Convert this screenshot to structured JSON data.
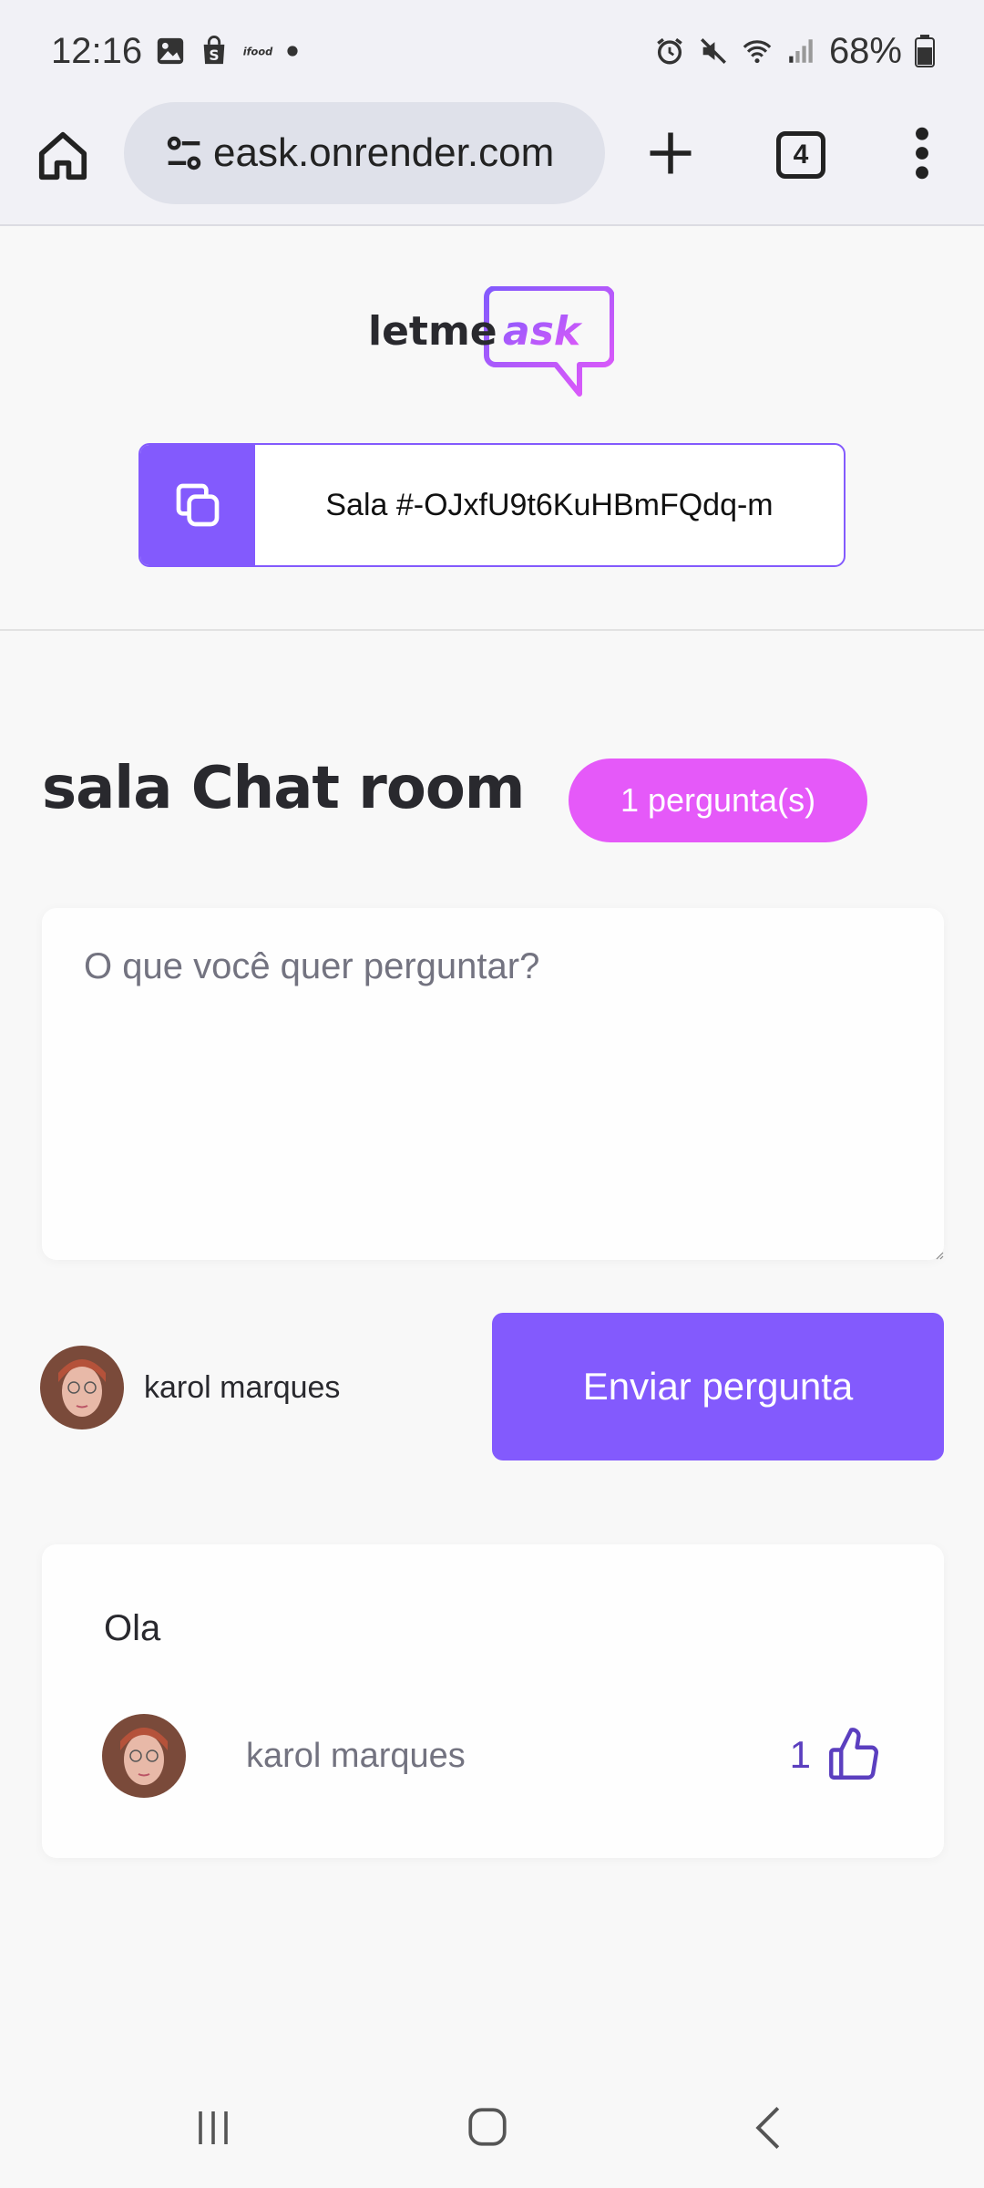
{
  "status_bar": {
    "time": "12:16",
    "notif_icons": [
      "image-icon",
      "shopping-bag-icon",
      "ifood-icon",
      "dot-icon"
    ],
    "system_icons": [
      "alarm-icon",
      "mute-icon",
      "wifi-icon",
      "signal-icon"
    ],
    "battery": "68%"
  },
  "browser": {
    "url": "eask.onrender.com",
    "tab_count": "4"
  },
  "header": {
    "logo_text_1": "letme",
    "logo_text_2": "ask",
    "room_code": "Sala #-OJxfU9t6KuHBmFQdq-m"
  },
  "room": {
    "title": "sala Chat room",
    "question_count": "1 pergunta(s)"
  },
  "form": {
    "placeholder": "O que você quer perguntar?",
    "user_name": "karol marques",
    "send_label": "Enviar pergunta"
  },
  "questions": [
    {
      "content": "Ola",
      "author": "karol marques",
      "likes": "1"
    }
  ],
  "colors": {
    "primary": "#835afd",
    "pink": "#e559f9",
    "background": "#f8f8f8",
    "text": "#29292e",
    "muted": "#737380"
  }
}
